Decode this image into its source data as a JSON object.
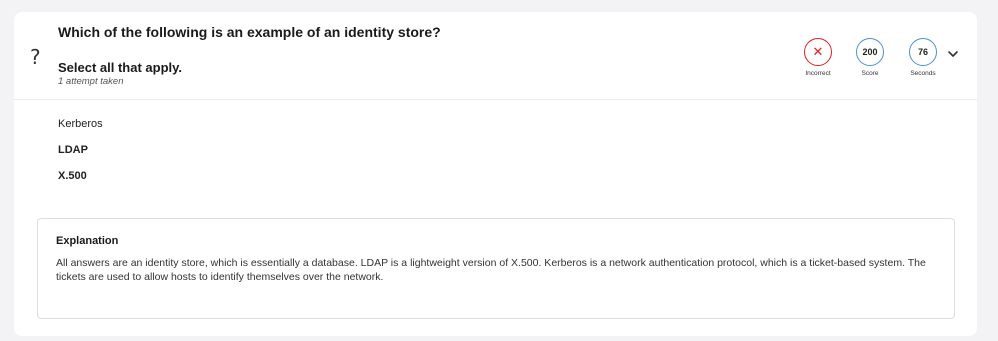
{
  "question": {
    "title": "Which of the following is an example of an identity store?",
    "instruction": "Select all that apply.",
    "attempts": "1 attempt taken"
  },
  "stats": {
    "result": {
      "label": "Incorrect",
      "icon": "close-icon",
      "color": "#e02020"
    },
    "score": {
      "value": "200",
      "label": "Score"
    },
    "seconds": {
      "value": "76",
      "label": "Seconds"
    }
  },
  "options": [
    {
      "label": "Kerberos",
      "selected": false
    },
    {
      "label": "LDAP",
      "selected": true
    },
    {
      "label": "X.500",
      "selected": true
    }
  ],
  "explanation": {
    "title": "Explanation",
    "body": "All answers are an identity store, which is essentially a database. LDAP is a lightweight version of X.500. Kerberos is a network authentication protocol, which is a ticket-based system. The tickets are used to allow hosts to identify themselves over the network."
  },
  "colors": {
    "accent": "#4f8fd1",
    "incorrect": "#e02020",
    "background": "#f3f3f5"
  }
}
